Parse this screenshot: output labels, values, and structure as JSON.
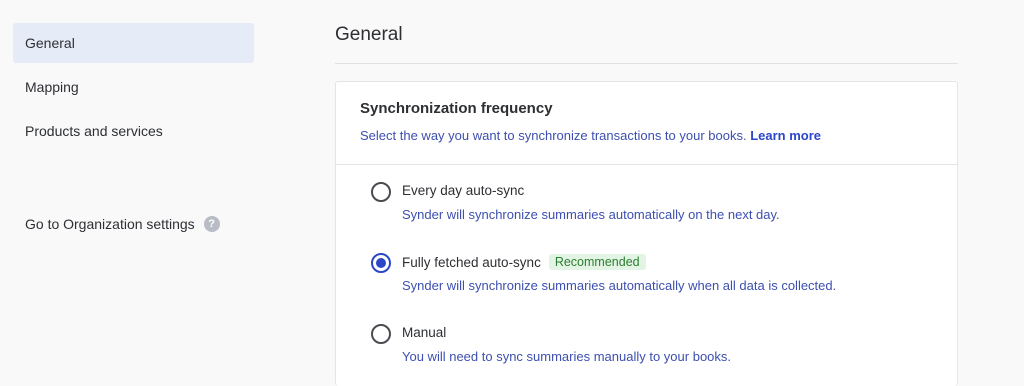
{
  "sidebar": {
    "items": [
      {
        "label": "General",
        "active": true
      },
      {
        "label": "Mapping",
        "active": false
      },
      {
        "label": "Products and services",
        "active": false
      }
    ],
    "org_settings_label": "Go to Organization settings",
    "help_icon": "?"
  },
  "main": {
    "title": "General",
    "card": {
      "title": "Synchronization frequency",
      "subtitle": "Select the way you want to synchronize transactions to your books.",
      "learn_more": "Learn more",
      "options": [
        {
          "label": "Every day auto-sync",
          "description": "Synder will synchronize summaries automatically on the next day.",
          "selected": false
        },
        {
          "label": "Fully fetched auto-sync",
          "badge": "Recommended",
          "description": "Synder will synchronize summaries automatically when all data is collected.",
          "selected": true
        },
        {
          "label": "Manual",
          "description": "You will need to sync summaries manually to your books.",
          "selected": false
        }
      ]
    }
  },
  "colors": {
    "accent": "#2b47c7",
    "active_nav_bg": "#e6ebf8",
    "badge_bg": "#e2f4e3",
    "badge_text": "#2e7d32"
  }
}
